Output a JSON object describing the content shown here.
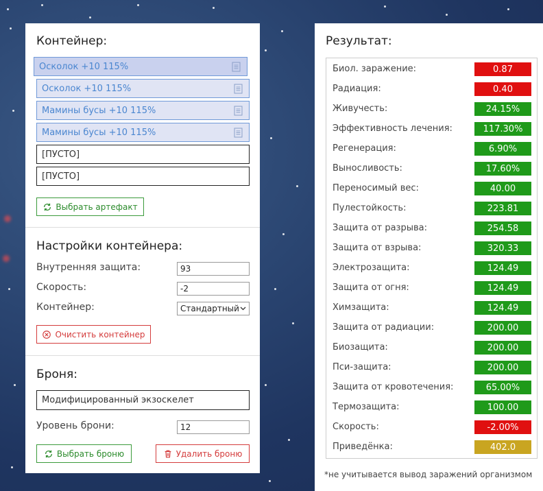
{
  "colors": {
    "green": "#1f9a1a",
    "red": "#e01010",
    "gold": "#c9a521",
    "accent_blue": "#4a86d0"
  },
  "container": {
    "title": "Контейнер:",
    "slots": [
      {
        "label": "Осколок +10 115%",
        "state": "filled-selected",
        "icon": "document-icon"
      },
      {
        "label": "Осколок +10 115%",
        "state": "filled",
        "icon": "document-icon"
      },
      {
        "label": "Мамины бусы +10 115%",
        "state": "filled",
        "icon": "document-icon"
      },
      {
        "label": "Мамины бусы +10 115%",
        "state": "filled",
        "icon": "document-icon"
      },
      {
        "label": "[ПУСТО]",
        "state": "empty"
      },
      {
        "label": "[ПУСТО]",
        "state": "empty"
      }
    ],
    "choose_artifact_label": "Выбрать артефакт"
  },
  "container_settings": {
    "title": "Настройки контейнера:",
    "inner_protection_label": "Внутренняя защита:",
    "inner_protection_value": "93",
    "speed_label": "Скорость:",
    "speed_value": "-2",
    "container_label": "Контейнер:",
    "container_value": "Стандартный",
    "clear_label": "Очистить контейнер"
  },
  "armor": {
    "title": "Броня:",
    "name": "Модифицированный экзоскелет",
    "level_label": "Уровень брони:",
    "level_value": "12",
    "choose_label": "Выбрать броню",
    "delete_label": "Удалить броню"
  },
  "result": {
    "title": "Результат:",
    "rows": [
      {
        "label": "Биол. заражение:",
        "value": "0.87",
        "status": "red"
      },
      {
        "label": "Радиация:",
        "value": "0.40",
        "status": "red"
      },
      {
        "label": "Живучесть:",
        "value": "24.15%",
        "status": "green"
      },
      {
        "label": "Эффективность лечения:",
        "value": "117.30%",
        "status": "green"
      },
      {
        "label": "Регенерация:",
        "value": "6.90%",
        "status": "green"
      },
      {
        "label": "Выносливость:",
        "value": "17.60%",
        "status": "green"
      },
      {
        "label": "Переносимый вес:",
        "value": "40.00",
        "status": "green"
      },
      {
        "label": "Пулестойкость:",
        "value": "223.81",
        "status": "green"
      },
      {
        "label": "Защита от разрыва:",
        "value": "254.58",
        "status": "green"
      },
      {
        "label": "Защита от взрыва:",
        "value": "320.33",
        "status": "green"
      },
      {
        "label": "Электрозащита:",
        "value": "124.49",
        "status": "green"
      },
      {
        "label": "Защита от огня:",
        "value": "124.49",
        "status": "green"
      },
      {
        "label": "Химзащита:",
        "value": "124.49",
        "status": "green"
      },
      {
        "label": "Защита от радиации:",
        "value": "200.00",
        "status": "green"
      },
      {
        "label": "Биозащита:",
        "value": "200.00",
        "status": "green"
      },
      {
        "label": "Пси-защита:",
        "value": "200.00",
        "status": "green"
      },
      {
        "label": "Защита от кровотечения:",
        "value": "65.00%",
        "status": "green"
      },
      {
        "label": "Термозащита:",
        "value": "100.00",
        "status": "green"
      },
      {
        "label": "Скорость:",
        "value": "-2.00%",
        "status": "red"
      },
      {
        "label": "Приведёнка:",
        "value": "402.0",
        "status": "gold"
      }
    ],
    "note": "*не учитывается вывод заражений организмом"
  }
}
